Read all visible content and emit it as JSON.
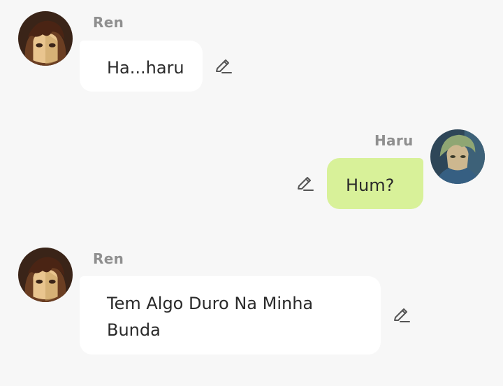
{
  "messages": [
    {
      "sender": "Ren",
      "text": "Ha...haru",
      "side": "incoming",
      "avatar": "ren-avatar"
    },
    {
      "sender": "Haru",
      "text": "Hum?",
      "side": "outgoing",
      "avatar": "haru-avatar"
    },
    {
      "sender": "Ren",
      "text": "Tem Algo Duro Na Minha Bunda",
      "side": "incoming",
      "avatar": "ren-avatar"
    }
  ],
  "icons": {
    "edit": "pencil-edit-icon"
  },
  "colors": {
    "background": "#f7f7f7",
    "incoming_bubble": "#ffffff",
    "outgoing_bubble": "#d8f199",
    "name_text": "#8f8f8f",
    "message_text": "#2a2a2a"
  }
}
